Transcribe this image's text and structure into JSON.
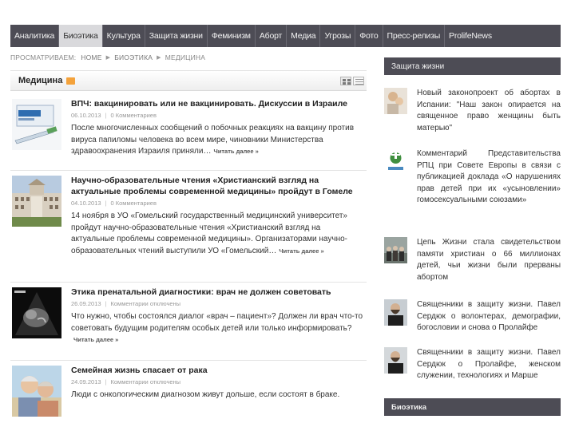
{
  "nav": {
    "items": [
      {
        "label": "Аналитика",
        "active": false
      },
      {
        "label": "Биоэтика",
        "active": true
      },
      {
        "label": "Культура",
        "active": false
      },
      {
        "label": "Защита жизни",
        "active": false
      },
      {
        "label": "Феминизм",
        "active": false
      },
      {
        "label": "Аборт",
        "active": false
      },
      {
        "label": "Медиа",
        "active": false
      },
      {
        "label": "Угрозы",
        "active": false
      },
      {
        "label": "Фото",
        "active": false
      },
      {
        "label": "Пресс-релизы",
        "active": false
      },
      {
        "label": "ProlifeNews",
        "active": false
      }
    ]
  },
  "breadcrumb": {
    "prefix": "Просматриваем:",
    "items": [
      "Home",
      "Биоэтика",
      "Медицина"
    ]
  },
  "section": {
    "title": "Медицина",
    "rss_icon": "rss-icon",
    "view_icons": [
      "grid-view-icon",
      "list-view-icon"
    ]
  },
  "articles": [
    {
      "title": "ВПЧ: вакцинировать или не вакцинировать. Дискуссии в Израиле",
      "date": "06.10.2013",
      "comments": "0 Комментариев",
      "text": "После многочисленных сообщений о побочных реакциях на вакцину против вируса папиломы человека во всем мире, чиновники Министерства здравоохранения Израиля приняли…",
      "read_more": "Читать далее »"
    },
    {
      "title": "Научно-образовательные чтения «Христианский взгляд на актуальные проблемы современной медицины» пройдут в Гомеле",
      "date": "04.10.2013",
      "comments": "0 Комментариев",
      "text": "14 ноября в УО «Гомельский государственный медицинский университет» пройдут научно-образовательные чтения «Христианский взгляд на актуальные проблемы современной медицины». Организаторами научно-образовательных чтений выступили УО «Гомельский…",
      "read_more": "Читать далее »"
    },
    {
      "title": "Этика пренатальной диагностики: врач не должен советовать",
      "date": "26.09.2013",
      "comments": "Комментарии отключены",
      "text": "Что нужно, чтобы состоялся диалог «врач – пациент»? Должен ли врач что-то советовать будущим родителям особых детей или только информировать?",
      "read_more": "Читать далее »"
    },
    {
      "title": "Семейная жизнь спасает от рака",
      "date": "24.09.2013",
      "comments": "Комментарии отключены",
      "text": "Люди с онкологическим диагнозом живут дольше, если состоят в браке.",
      "read_more": ""
    }
  ],
  "sidebar": {
    "heading": "Защита жизни",
    "items": [
      {
        "text": "Новый законопроект об абортах в Испании: \"Наш закон опирается на священное право женщины быть матерью\""
      },
      {
        "text": "Комментарий Представительства РПЦ при Совете Европы в связи с публикацией доклада «О нарушениях прав детей при их «усыновлении» гомосексуальными союзами»"
      },
      {
        "text": "Цепь Жизни стала свидетельством памяти христиан о 66 миллионах детей, чьи жизни были прерваны абортом"
      },
      {
        "text": "Священники в защиту жизни. Павел Сердюк о волонтерах, демографии, богословии и снова о Пролайфе"
      },
      {
        "text": "Священники в защиту жизни. Павел Сердюк о Пролайфе, женском служении, технологиях и Марше"
      }
    ],
    "second_heading": "Биоэтика"
  }
}
